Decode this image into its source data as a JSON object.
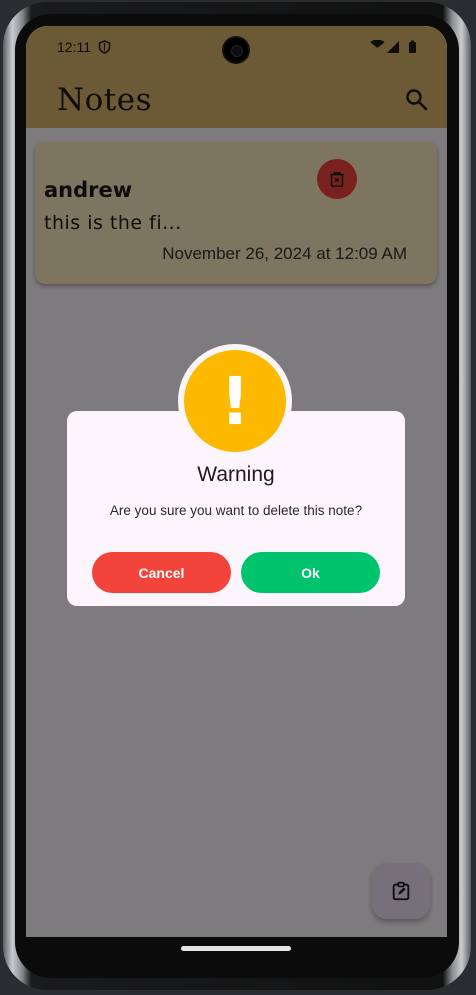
{
  "status_bar": {
    "time": "12:11"
  },
  "app_bar": {
    "title": "Notes"
  },
  "note": {
    "title": "andrew",
    "body": "this is the fi...",
    "date": "November 26, 2024 at 12:09 AM"
  },
  "dialog": {
    "icon_glyph": "!",
    "title": "Warning",
    "message": "Are you sure you want to delete this note?",
    "cancel_label": "Cancel",
    "ok_label": "Ok"
  },
  "colors": {
    "app_bar": "#d7b56a",
    "card": "#fbeac0",
    "danger": "#f2443a",
    "success": "#00c36d",
    "warning": "#fdb900"
  },
  "icons": {
    "status": [
      "shield-icon",
      "wifi-icon",
      "signal-icon",
      "battery-icon"
    ],
    "app_bar": [
      "search-icon"
    ],
    "card": [
      "trash-icon"
    ],
    "fab": [
      "edit-note-icon"
    ]
  }
}
